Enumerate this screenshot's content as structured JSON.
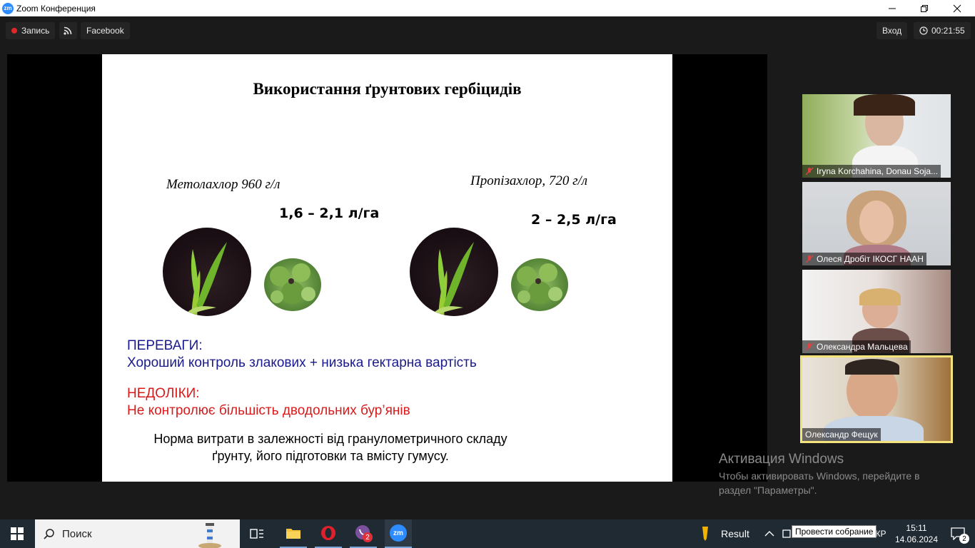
{
  "window": {
    "app_title": "Zoom Конференция",
    "logo_text": "zm"
  },
  "toolbar": {
    "record_label": "Запись",
    "facebook_label": "Facebook",
    "signin_label": "Вход",
    "timer": "00:21:55"
  },
  "slide": {
    "title": "Використання ґрунтових гербіцидів",
    "herbicide_1": "Метолахлор 960 г/л",
    "rate_1": "1,6 – 2,1 л/га",
    "herbicide_2": "Пропізахлор, 720 г/л",
    "rate_2": "2 – 2,5 л/га",
    "advantages_head": "ПЕРЕВАГИ:",
    "advantages_text": "Хороший контроль злакових + низька гектарна вартість",
    "drawbacks_head": "НЕДОЛІКИ:",
    "drawbacks_text": "Не контролює більшість дводольних бур’янів",
    "footer_line1": "Норма витрати в залежності від гранулометричного складу",
    "footer_line2": "ґрунту, його підготовки та вмісту гумусу.",
    "colors": {
      "advantages": "#1a1a8c",
      "drawbacks": "#d81a1a"
    }
  },
  "participants": [
    {
      "name": "Iryna Korchahina, Donau Soja...",
      "muted": true
    },
    {
      "name": "Олеся Дробіт ІКОСГ НААН",
      "muted": true
    },
    {
      "name": "Олександра Мальцева",
      "muted": true
    },
    {
      "name": "Олександр Фещук",
      "muted": false,
      "active_speaker": true
    }
  ],
  "watermark": {
    "title": "Активация Windows",
    "line1": "Чтобы активировать Windows, перейдите в",
    "line2": "раздел \"Параметры\"."
  },
  "taskbar": {
    "search_placeholder": "Поиск",
    "result_label": "Result",
    "tooltip": "Провести собрание",
    "lang_fragment": "КР",
    "time": "15:11",
    "date": "14.06.2024",
    "viber_badge": "2",
    "notifications_badge": "2"
  }
}
